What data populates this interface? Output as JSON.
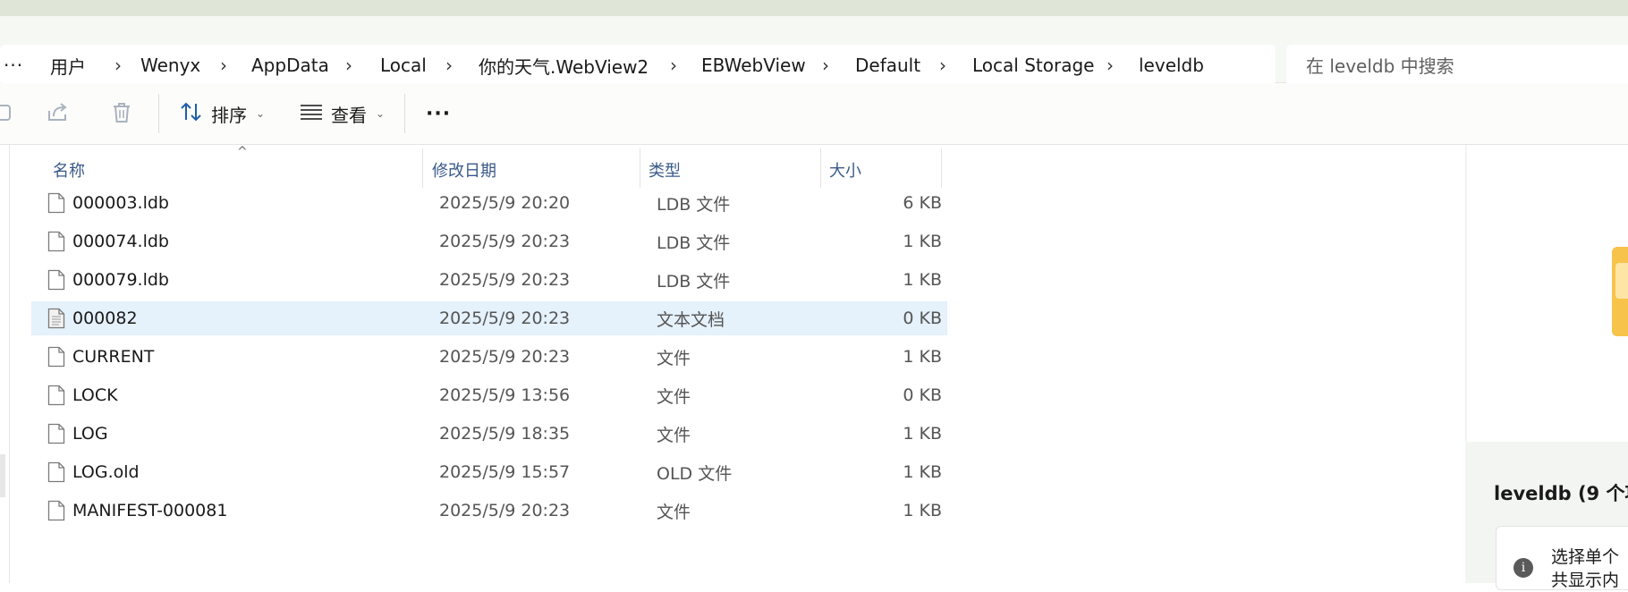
{
  "breadcrumb": {
    "more": "···",
    "items": [
      "用户",
      "Wenyx",
      "AppData",
      "Local",
      "你的天气.WebView2",
      "EBWebView",
      "Default",
      "Local Storage",
      "leveldb"
    ],
    "separator": "›"
  },
  "search": {
    "placeholder": "在 leveldb 中搜索"
  },
  "toolbar": {
    "sort_label": "排序",
    "view_label": "查看",
    "more_label": "···"
  },
  "columns": {
    "name": "名称",
    "date": "修改日期",
    "type": "类型",
    "size": "大小"
  },
  "files": [
    {
      "name": "000003.ldb",
      "date": "2025/5/9 20:20",
      "type": "LDB 文件",
      "size": "6 KB",
      "icon": "file-icon"
    },
    {
      "name": "000074.ldb",
      "date": "2025/5/9 20:23",
      "type": "LDB 文件",
      "size": "1 KB",
      "icon": "file-icon"
    },
    {
      "name": "000079.ldb",
      "date": "2025/5/9 20:23",
      "type": "LDB 文件",
      "size": "1 KB",
      "icon": "file-icon"
    },
    {
      "name": "000082",
      "date": "2025/5/9 20:23",
      "type": "文本文档",
      "size": "0 KB",
      "icon": "text-file-icon",
      "selected": true
    },
    {
      "name": "CURRENT",
      "date": "2025/5/9 20:23",
      "type": "文件",
      "size": "1 KB",
      "icon": "file-icon"
    },
    {
      "name": "LOCK",
      "date": "2025/5/9 13:56",
      "type": "文件",
      "size": "0 KB",
      "icon": "file-icon"
    },
    {
      "name": "LOG",
      "date": "2025/5/9 18:35",
      "type": "文件",
      "size": "1 KB",
      "icon": "file-icon"
    },
    {
      "name": "LOG.old",
      "date": "2025/5/9 15:57",
      "type": "OLD 文件",
      "size": "1 KB",
      "icon": "file-icon"
    },
    {
      "name": "MANIFEST-000081",
      "date": "2025/5/9 20:23",
      "type": "文件",
      "size": "1 KB",
      "icon": "file-icon"
    }
  ],
  "preview": {
    "title": "leveldb (9 个项",
    "info_line1": "选择单个",
    "info_line2": "共显示内"
  },
  "colors": {
    "selection": "#e5f1fb",
    "header_text": "#3a5a8a",
    "accent": "#0067c0",
    "folder": "#f7c34b"
  }
}
